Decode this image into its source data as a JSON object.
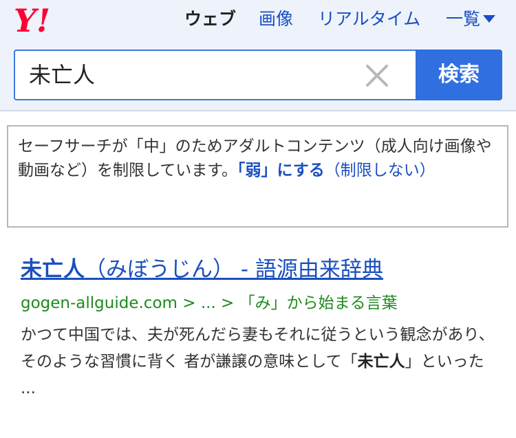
{
  "header": {
    "logo_text": "Y!",
    "nav": {
      "web": "ウェブ",
      "images": "画像",
      "realtime": "リアルタイム",
      "more": "一覧"
    }
  },
  "search": {
    "query": "未亡人",
    "button_label": "検索"
  },
  "notice": {
    "text_part1": "セーフサーチが「中」のためアダルトコンテンツ（成人向け画像や動画など）を制限しています。",
    "weak_link": "「弱」にする",
    "limit_link": "（制限しない）"
  },
  "result": {
    "title_bold": "未亡人",
    "title_rest": "（みぼうじん） - 語源由来辞典",
    "url": "gogen-allguide.com > ... > 「み」から始まる言葉",
    "snippet_part1": "かつて中国では、夫が死んだら妻もそれに従うという観念があり、そのような習慣に背く 者が謙譲の意味として「",
    "snippet_bold": "未亡人",
    "snippet_part2": "」といった ..."
  },
  "colors": {
    "logo_red": "#ff0033",
    "link_blue": "#1a4fbf",
    "button_blue": "#2f6fe0",
    "url_green": "#1e8a1e",
    "header_bg": "#eef3fb"
  }
}
